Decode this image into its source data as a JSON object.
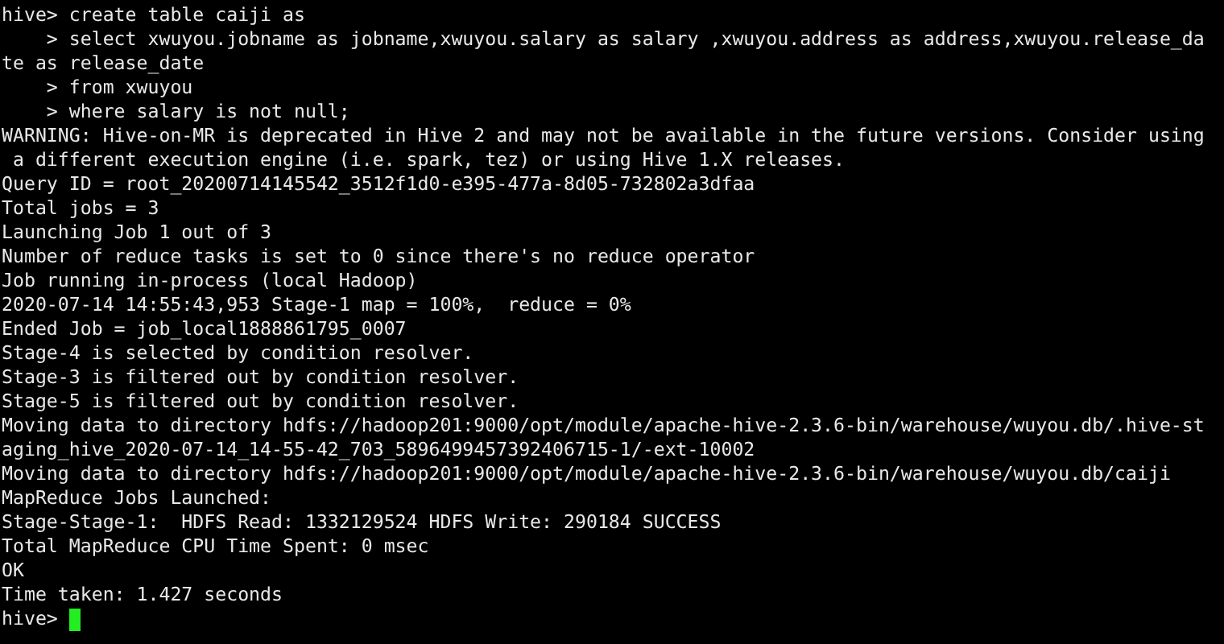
{
  "terminal": {
    "lines": [
      "hive> create table caiji as",
      "    > select xwuyou.jobname as jobname,xwuyou.salary as salary ,xwuyou.address as address,xwuyou.release_da",
      "te as release_date",
      "    > from xwuyou",
      "    > where salary is not null;",
      "WARNING: Hive-on-MR is deprecated in Hive 2 and may not be available in the future versions. Consider using",
      " a different execution engine (i.e. spark, tez) or using Hive 1.X releases.",
      "Query ID = root_20200714145542_3512f1d0-e395-477a-8d05-732802a3dfaa",
      "Total jobs = 3",
      "Launching Job 1 out of 3",
      "Number of reduce tasks is set to 0 since there's no reduce operator",
      "Job running in-process (local Hadoop)",
      "2020-07-14 14:55:43,953 Stage-1 map = 100%,  reduce = 0%",
      "Ended Job = job_local1888861795_0007",
      "Stage-4 is selected by condition resolver.",
      "Stage-3 is filtered out by condition resolver.",
      "Stage-5 is filtered out by condition resolver.",
      "Moving data to directory hdfs://hadoop201:9000/opt/module/apache-hive-2.3.6-bin/warehouse/wuyou.db/.hive-st",
      "aging_hive_2020-07-14_14-55-42_703_5896499457392406715-1/-ext-10002",
      "Moving data to directory hdfs://hadoop201:9000/opt/module/apache-hive-2.3.6-bin/warehouse/wuyou.db/caiji",
      "MapReduce Jobs Launched:",
      "Stage-Stage-1:  HDFS Read: 1332129524 HDFS Write: 290184 SUCCESS",
      "Total MapReduce CPU Time Spent: 0 msec",
      "OK",
      "Time taken: 1.427 seconds"
    ],
    "prompt": "hive>"
  }
}
